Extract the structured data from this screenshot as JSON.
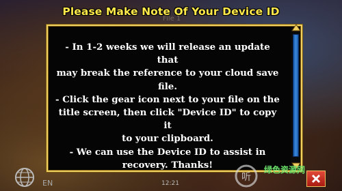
{
  "title": "Please Make Note Of Your Device ID",
  "background_label": "File 1",
  "message": {
    "lines": [
      "- In 1-2 weeks we will release an update that",
      "may break the reference to your cloud save",
      "file.",
      "- Click the gear icon next to your file on the",
      "title screen, then click \"Device ID\" to copy it",
      "to your clipboard.",
      "- We can use the Device ID to assist in",
      "recovery. Thanks!"
    ]
  },
  "footer": {
    "language": "EN",
    "clock": "12:21"
  },
  "watermark": {
    "text": "绿色资源网"
  },
  "icons": {
    "globe": "globe-icon",
    "close": "close-icon",
    "scroll_up": "chevron-up-icon",
    "scroll_down": "chevron-down-icon"
  },
  "colors": {
    "title": "#ffe84a",
    "border": "#f0d060",
    "scroll": "#3a8ae0",
    "close": "#d0302a"
  }
}
